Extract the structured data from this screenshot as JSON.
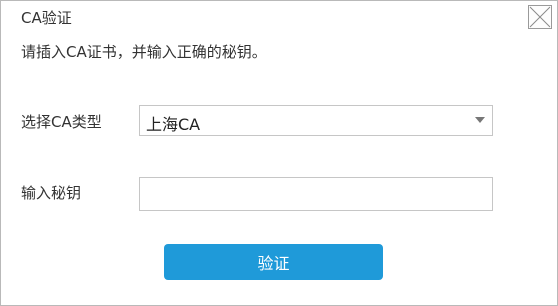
{
  "dialog": {
    "title": "CA验证",
    "close_icon": "close-icon",
    "instruction": "请插入CA证书，并输入正确的秘钥。"
  },
  "ca_type": {
    "label": "选择CA类型",
    "selected": "上海CA",
    "arrow_icon": "chevron-down-icon"
  },
  "secret_key": {
    "label": "输入秘钥",
    "value": "",
    "placeholder": ""
  },
  "actions": {
    "verify_label": "验证"
  },
  "colors": {
    "accent": "#1f9ad9",
    "text": "#333333",
    "border": "#c6c6c6"
  }
}
